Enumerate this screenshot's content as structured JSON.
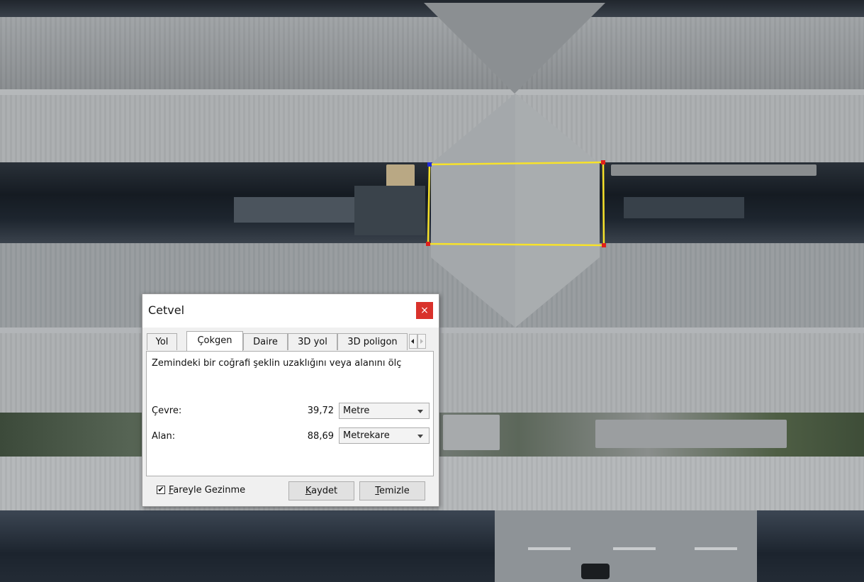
{
  "dialog": {
    "title": "Cetvel",
    "close_glyph": "×",
    "tabs": [
      {
        "label": "Yol",
        "active": false
      },
      {
        "label": "Çokgen",
        "active": true
      },
      {
        "label": "Daire",
        "active": false
      },
      {
        "label": "3D yol",
        "active": false
      },
      {
        "label": "3D poligon",
        "active": false
      }
    ],
    "description": "Zemindeki bir coğrafi şeklin uzaklığını veya alanını ölç",
    "perimeter": {
      "label": "Çevre:",
      "value": "39,72",
      "unit": "Metre"
    },
    "area": {
      "label": "Alan:",
      "value": "88,69",
      "unit": "Metrekare"
    },
    "mouse_nav": {
      "checked": true,
      "check_glyph": "✔",
      "label_first": "F",
      "label_rest": "areyle Gezinme"
    },
    "save": {
      "first": "K",
      "rest": "aydet"
    },
    "clear": {
      "first": "T",
      "rest": "emizle"
    }
  },
  "icons": {
    "close": "close-icon",
    "tab_left": "chevron-left-icon",
    "tab_right": "chevron-right-icon",
    "dropdown": "chevron-down-icon"
  },
  "colors": {
    "polygon_stroke": "#f7e22a",
    "vertex": "#e0201a",
    "active_vertex": "#1f2bd8",
    "close_button": "#d9322b"
  }
}
